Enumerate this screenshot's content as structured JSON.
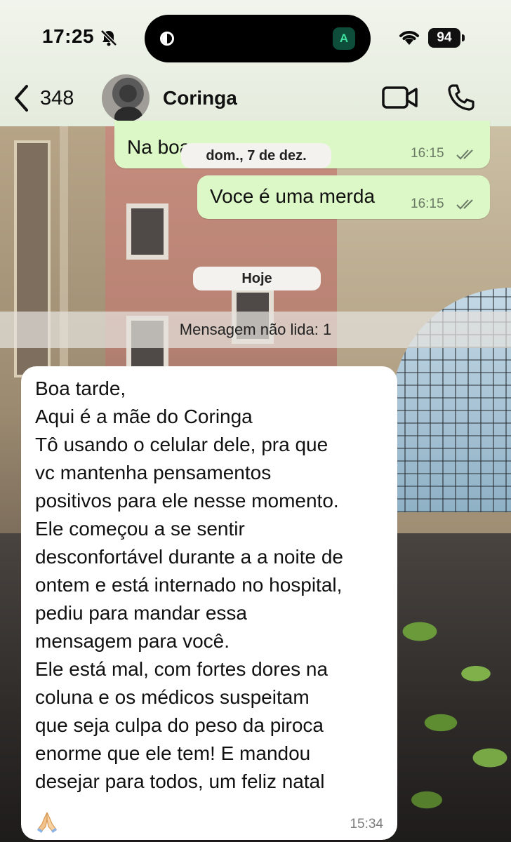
{
  "status_bar": {
    "time": "17:25",
    "bell_icon": "bell-slash-icon",
    "island_badge": "A",
    "battery": "94"
  },
  "header": {
    "back_count": "348",
    "contact_name": "Coringa",
    "video_icon": "video-camera-icon",
    "call_icon": "phone-icon"
  },
  "messages": {
    "out_1": {
      "text": "Na boa",
      "time": "16:15",
      "status": "read"
    },
    "date_divider": "dom., 7 de dez.",
    "out_2": {
      "text": "Voce é uma merda",
      "time": "16:15",
      "status": "read"
    },
    "today_divider": "Hoje",
    "unread_banner": "Mensagem não lida: 1",
    "incoming": {
      "lines": [
        "Boa tarde,",
        "Aqui é a mãe do Coringa",
        "Tô usando o celular dele, pra que",
        "vc mantenha pensamentos",
        "positivos para ele nesse momento.",
        "Ele começou a se sentir",
        "desconfortável durante a a noite de",
        "ontem e está internado no hospital,",
        "pediu para mandar essa",
        "mensagem para você.",
        "Ele está mal, com fortes dores na",
        "coluna e os médicos suspeitam",
        "que seja culpa do peso da piroca",
        "enorme que ele tem! E mandou",
        "desejar para todos, um feliz natal"
      ],
      "emoji": "folded-hands-icon",
      "time": "15:34"
    }
  },
  "colors": {
    "outgoing_bubble": "#dcf8c6",
    "incoming_bubble": "#ffffff",
    "header_bg": "#e9efe3"
  }
}
